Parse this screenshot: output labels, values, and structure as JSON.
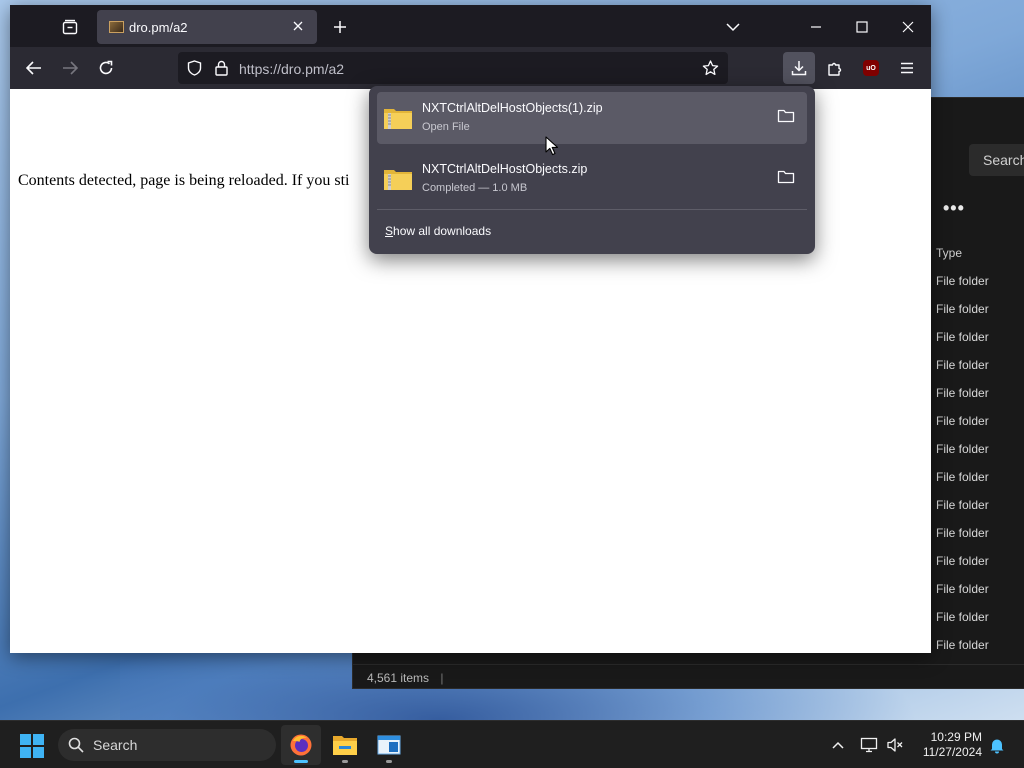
{
  "browser": {
    "tab": {
      "title": "dro.pm/a2"
    },
    "url": {
      "scheme_host": "https://dro.pm/a2"
    },
    "page_text": "Contents detected, page is being reloaded. If you sti"
  },
  "downloads_panel": {
    "items": [
      {
        "filename": "NXTCtrlAltDelHostObjects(1).zip",
        "status": "Open File"
      },
      {
        "filename": "NXTCtrlAltDelHostObjects.zip",
        "status": "Completed — 1.0 MB"
      }
    ],
    "show_all_prefix": "S",
    "show_all_rest": "how all downloads"
  },
  "explorer": {
    "search_label": "Search",
    "more_label": "•••",
    "type_header": "Type",
    "type_rows": [
      "File folder",
      "File folder",
      "File folder",
      "File folder",
      "File folder",
      "File folder",
      "File folder",
      "File folder",
      "File folder",
      "File folder",
      "File folder",
      "File folder",
      "File folder",
      "File folder"
    ],
    "status": "4,561 items"
  },
  "taskbar": {
    "search_label": "Search",
    "time": "10:29 PM",
    "date": "11/27/2024"
  },
  "colors": {
    "accent": "#4cc2ff",
    "firefox_toolbar": "#2b2a33",
    "panel_bg": "#42414d"
  }
}
